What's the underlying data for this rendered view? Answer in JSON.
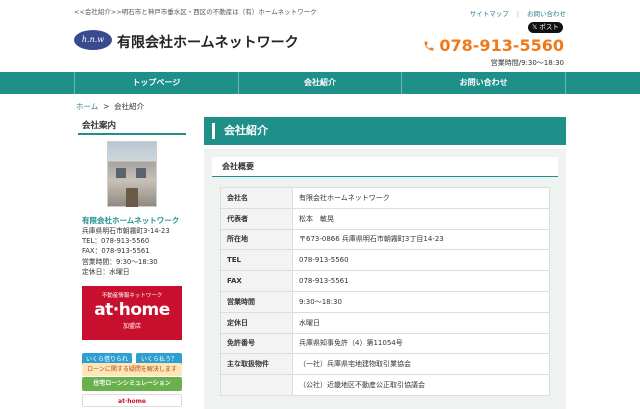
{
  "header": {
    "crumb_text": "<<会社紹介>>明石市と神戸市垂水区・西区の不動産は（有）ホームネットワーク",
    "links": [
      "サイトマップ",
      "お問い合わせ"
    ],
    "post_label": "𝕏 ポスト",
    "logo_text": "h.n.w",
    "company_name": "有限会社ホームネットワーク",
    "phone": "078-913-5560",
    "hours": "営業時間/9:30〜18:30"
  },
  "nav": {
    "items": [
      "トップページ",
      "会社紹介",
      "お問い合わせ"
    ]
  },
  "breadcrumb": {
    "home": "ホーム",
    "sep": ">",
    "current": "会社紹介"
  },
  "sidebar": {
    "title": "会社案内",
    "name": "有限会社ホームネットワーク",
    "info": [
      "兵庫県明石市朝霧町3-14-23",
      "TEL：078-913-5560",
      "FAX：078-913-5561",
      "営業時間：9:30〜18:30",
      "定休日：水曜日"
    ],
    "athome": {
      "top": "不動産情報ネットワーク",
      "logo": "at·home",
      "bottom": "加盟店"
    },
    "banners": [
      "いくら借りられる？",
      "いくら払う？",
      "ローンに関する疑問を解決します",
      "住宅ローンシミュレーション",
      "at·home"
    ]
  },
  "main": {
    "title": "会社紹介",
    "section": "会社概要",
    "rows": [
      {
        "k": "会社名",
        "v": "有限会社ホームネットワーク"
      },
      {
        "k": "代表者",
        "v": "松本　敏晃"
      },
      {
        "k": "所在地",
        "v": "〒673-0866 兵庫県明石市朝霧町3丁目14-23"
      },
      {
        "k": "TEL",
        "v": "078-913-5560"
      },
      {
        "k": "FAX",
        "v": "078-913-5561"
      },
      {
        "k": "営業時間",
        "v": "9:30〜18:30"
      },
      {
        "k": "定休日",
        "v": "水曜日"
      },
      {
        "k": "免許番号",
        "v": "兵庫県知事免許（4）第11054号"
      },
      {
        "k": "主な取扱物件",
        "v": "（一社）兵庫県宅地建物取引業協会"
      },
      {
        "k": "",
        "v": "（公社）近畿地区不動産公正取引協議会"
      }
    ]
  },
  "colors": {
    "accent": "#1f8f8a",
    "phone": "#f07a1a",
    "athome": "#c8102e"
  }
}
